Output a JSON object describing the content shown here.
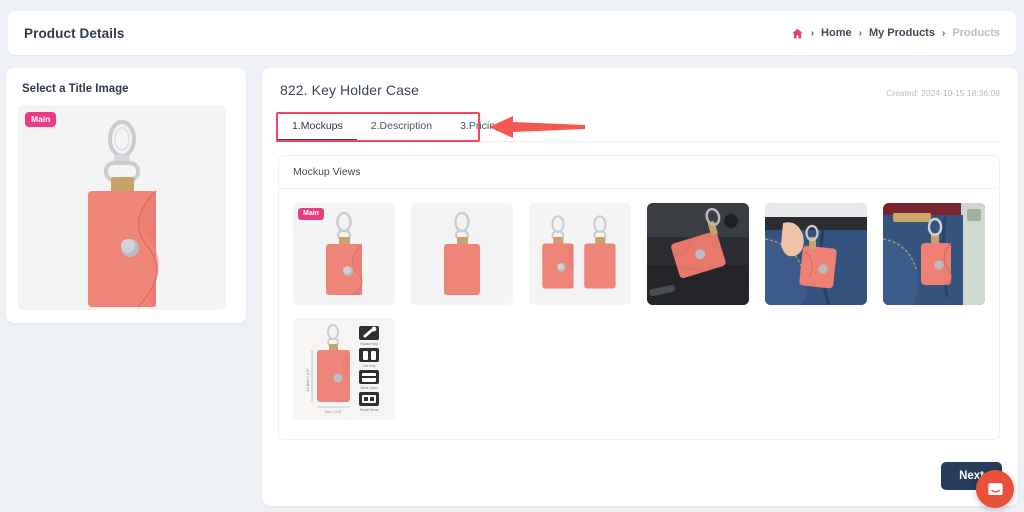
{
  "header": {
    "title": "Product Details",
    "breadcrumb": {
      "home_icon": "home-icon",
      "separator": "›",
      "items": [
        {
          "label": "Home",
          "current": false
        },
        {
          "label": "My Products",
          "current": false
        },
        {
          "label": "Products",
          "current": true
        }
      ]
    }
  },
  "sidebar": {
    "title": "Select a Title Image",
    "title_image": {
      "badge": "Main",
      "alt": "coral leather key holder case with wave flap and snap button"
    }
  },
  "main": {
    "product_title": "822. Key Holder Case",
    "created_label": "Created: 2024-10-15 18:36:08",
    "tabs": [
      {
        "label": "1.Mockups",
        "active": true
      },
      {
        "label": "2.Description",
        "active": false
      },
      {
        "label": "3.Pricing",
        "active": false
      }
    ],
    "mockup_panel": {
      "heading": "Mockup Views",
      "thumbnails": [
        {
          "kind": "product-front",
          "badge": "Main",
          "alt": "key holder front view with flap"
        },
        {
          "kind": "product-back",
          "badge": "",
          "alt": "key holder back view plain"
        },
        {
          "kind": "product-pair",
          "badge": "",
          "alt": "key holder front and back pair"
        },
        {
          "kind": "photo-desk",
          "badge": "",
          "alt": "key holder flat lay on dark desk"
        },
        {
          "kind": "photo-pocket",
          "badge": "",
          "alt": "hand pulling key holder from jeans pocket"
        },
        {
          "kind": "photo-belt",
          "badge": "",
          "alt": "key holder hanging from jeans belt loop"
        },
        {
          "kind": "spec-sheet",
          "badge": "",
          "alt": "dimension spec sheet with usage icons"
        }
      ]
    },
    "next_button": "Next"
  },
  "widgets": {
    "chat": "chat-bubble-icon"
  },
  "annotation": {
    "box_target": "tab-strip",
    "arrow": "left-arrow-pointer"
  },
  "colors": {
    "page_bg": "#eef1f6",
    "accent_pink": "#ec3b82",
    "annotation_red": "#f4465c",
    "next_navy": "#273b5b",
    "chat_orange": "#e8503a",
    "product_coral": "#ef8479"
  },
  "spec_icons": [
    {
      "label": "House Key"
    },
    {
      "label": "Car Key"
    },
    {
      "label": "Bank Card"
    },
    {
      "label": "Small Items"
    }
  ]
}
